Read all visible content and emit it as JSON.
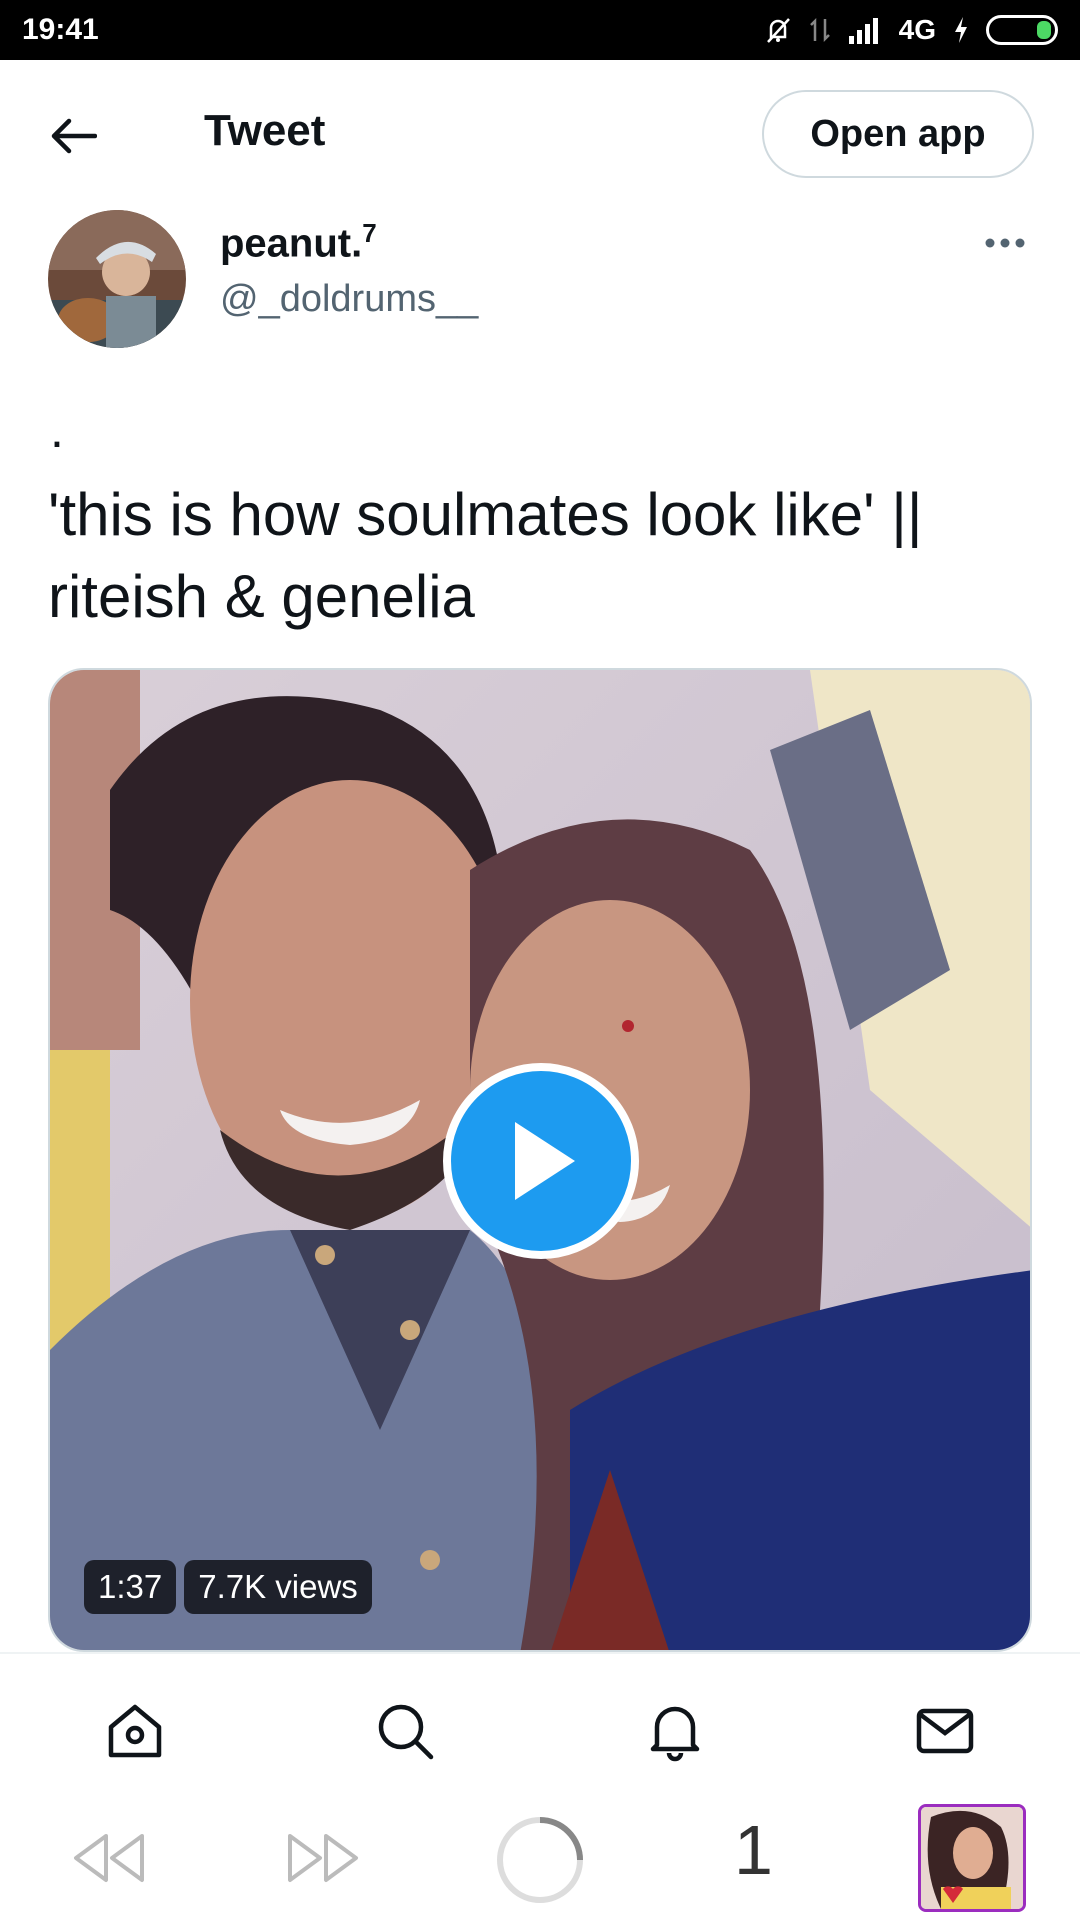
{
  "status_bar": {
    "time": "19:41",
    "network": "4G"
  },
  "header": {
    "title": "Tweet",
    "open_app_label": "Open app"
  },
  "author": {
    "display_name": "peanut.",
    "superscript": "7",
    "handle": "@_doldrums__"
  },
  "tweet": {
    "bullet": ".",
    "text": "'this is how soulmates look like' || riteish & genelia"
  },
  "media": {
    "duration": "1:37",
    "views": "7.7K views"
  },
  "bottom_nav": {
    "items": [
      "home-icon",
      "search-icon",
      "notifications-icon",
      "messages-icon"
    ]
  },
  "media_bar": {
    "counter": "1"
  },
  "colors": {
    "accent": "#1d9bf0",
    "text": "#0f1419",
    "secondary": "#536471",
    "border": "#cfd9de"
  }
}
